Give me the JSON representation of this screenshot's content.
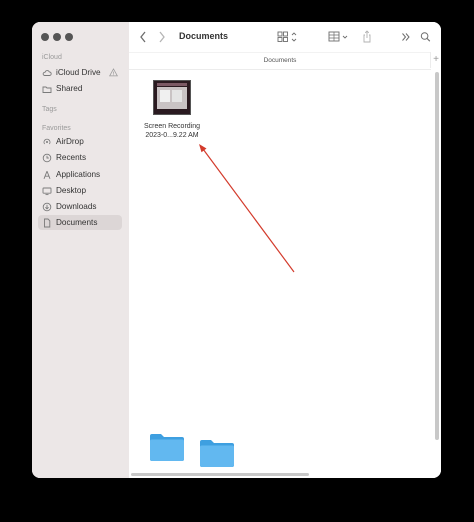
{
  "sidebar": {
    "icloud_label": "iCloud",
    "icloud_items": [
      {
        "label": "iCloud Drive",
        "icon": "cloud-icon"
      },
      {
        "label": "Shared",
        "icon": "shared-folder-icon"
      }
    ],
    "tags_label": "Tags",
    "favorites_label": "Favorites",
    "favorites_items": [
      {
        "label": "AirDrop",
        "icon": "airdrop-icon"
      },
      {
        "label": "Recents",
        "icon": "clock-icon"
      },
      {
        "label": "Applications",
        "icon": "applications-icon"
      },
      {
        "label": "Desktop",
        "icon": "desktop-icon"
      },
      {
        "label": "Downloads",
        "icon": "download-icon"
      },
      {
        "label": "Documents",
        "icon": "document-icon",
        "selected": true
      }
    ]
  },
  "toolbar": {
    "title": "Documents"
  },
  "pathbar": {
    "label": "Documents"
  },
  "files": [
    {
      "name_line1": "Screen Recording",
      "name_line2": "2023-0...9.22 AM"
    }
  ],
  "colors": {
    "sidebar_bg": "#ece7e7",
    "folder_blue": "#5fb5ec",
    "arrow_red": "#d33b2c"
  }
}
